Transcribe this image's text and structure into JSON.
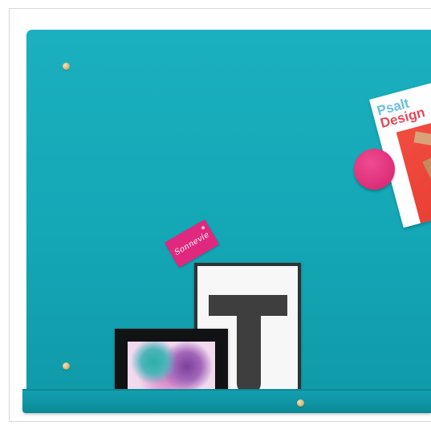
{
  "scene": {
    "description_tag": "wall-mounted-magnetic-board",
    "board_color": "#14a7b6",
    "shelf_color": "#0f94a2",
    "screw_color": "#d8b97a"
  },
  "items": {
    "business_card": {
      "text": "Sonnevie",
      "color": "#e0287f"
    },
    "t_poster": {
      "letter": "T"
    },
    "magazine": {
      "line1": "Psalt",
      "line2": "Design"
    },
    "magnet": {
      "color": "#e1327d"
    },
    "photo_frame": {
      "frame_color": "#111213"
    }
  }
}
